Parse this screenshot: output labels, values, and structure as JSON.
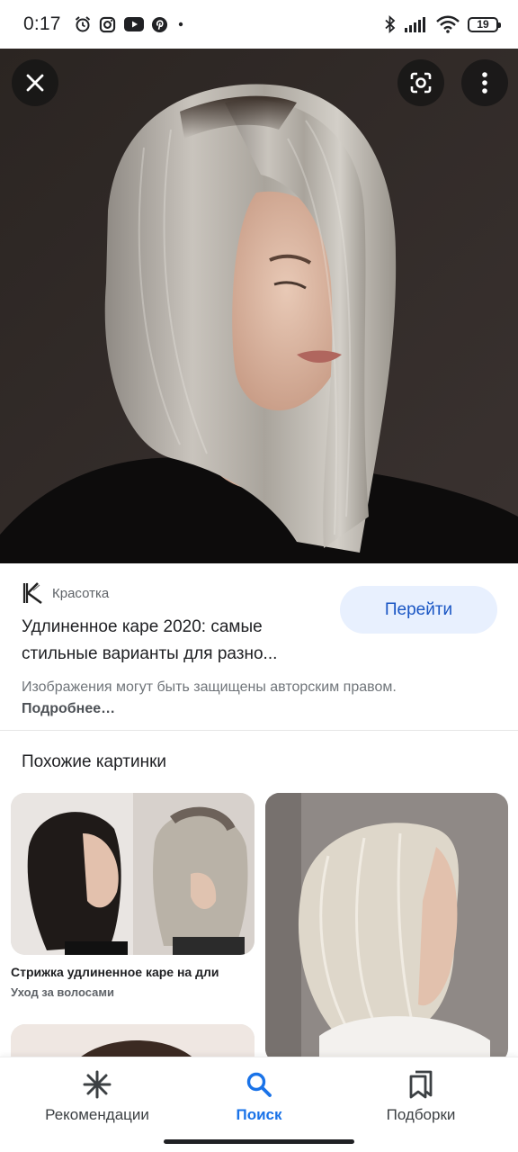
{
  "status_bar": {
    "time": "0:17",
    "left_icons": [
      "alarm-icon",
      "instagram-icon",
      "youtube-icon",
      "pinterest-icon",
      "dot-icon"
    ],
    "right_icons": [
      "bluetooth-icon",
      "signal-icon",
      "wifi-icon"
    ],
    "battery": "19"
  },
  "viewer": {
    "close_icon": "close-icon",
    "lens_icon": "google-lens-icon",
    "more_icon": "more-vert-icon"
  },
  "result": {
    "source_name": "Красотка",
    "title": "Удлиненное каре 2020: самые стильные варианты для разно...",
    "go_button": "Перейти",
    "copyright_text": "Изображения могут быть защищены авторским правом.",
    "copyright_link": "Подробнее…"
  },
  "similar": {
    "heading": "Похожие картинки",
    "cards": [
      {
        "caption": "Стрижка удлиненное каре на дли",
        "source": "Уход за волосами"
      }
    ]
  },
  "bottom_nav": {
    "items": [
      {
        "label": "Рекомендации",
        "icon": "asterisk-icon",
        "active": false
      },
      {
        "label": "Поиск",
        "icon": "search-icon",
        "active": true
      },
      {
        "label": "Подборки",
        "icon": "bookmarks-icon",
        "active": false
      }
    ]
  },
  "colors": {
    "accent": "#1a73e8",
    "button_bg": "#e8f0fe",
    "button_text": "#1a56c4",
    "text_primary": "#202124",
    "text_secondary": "#70757a"
  }
}
